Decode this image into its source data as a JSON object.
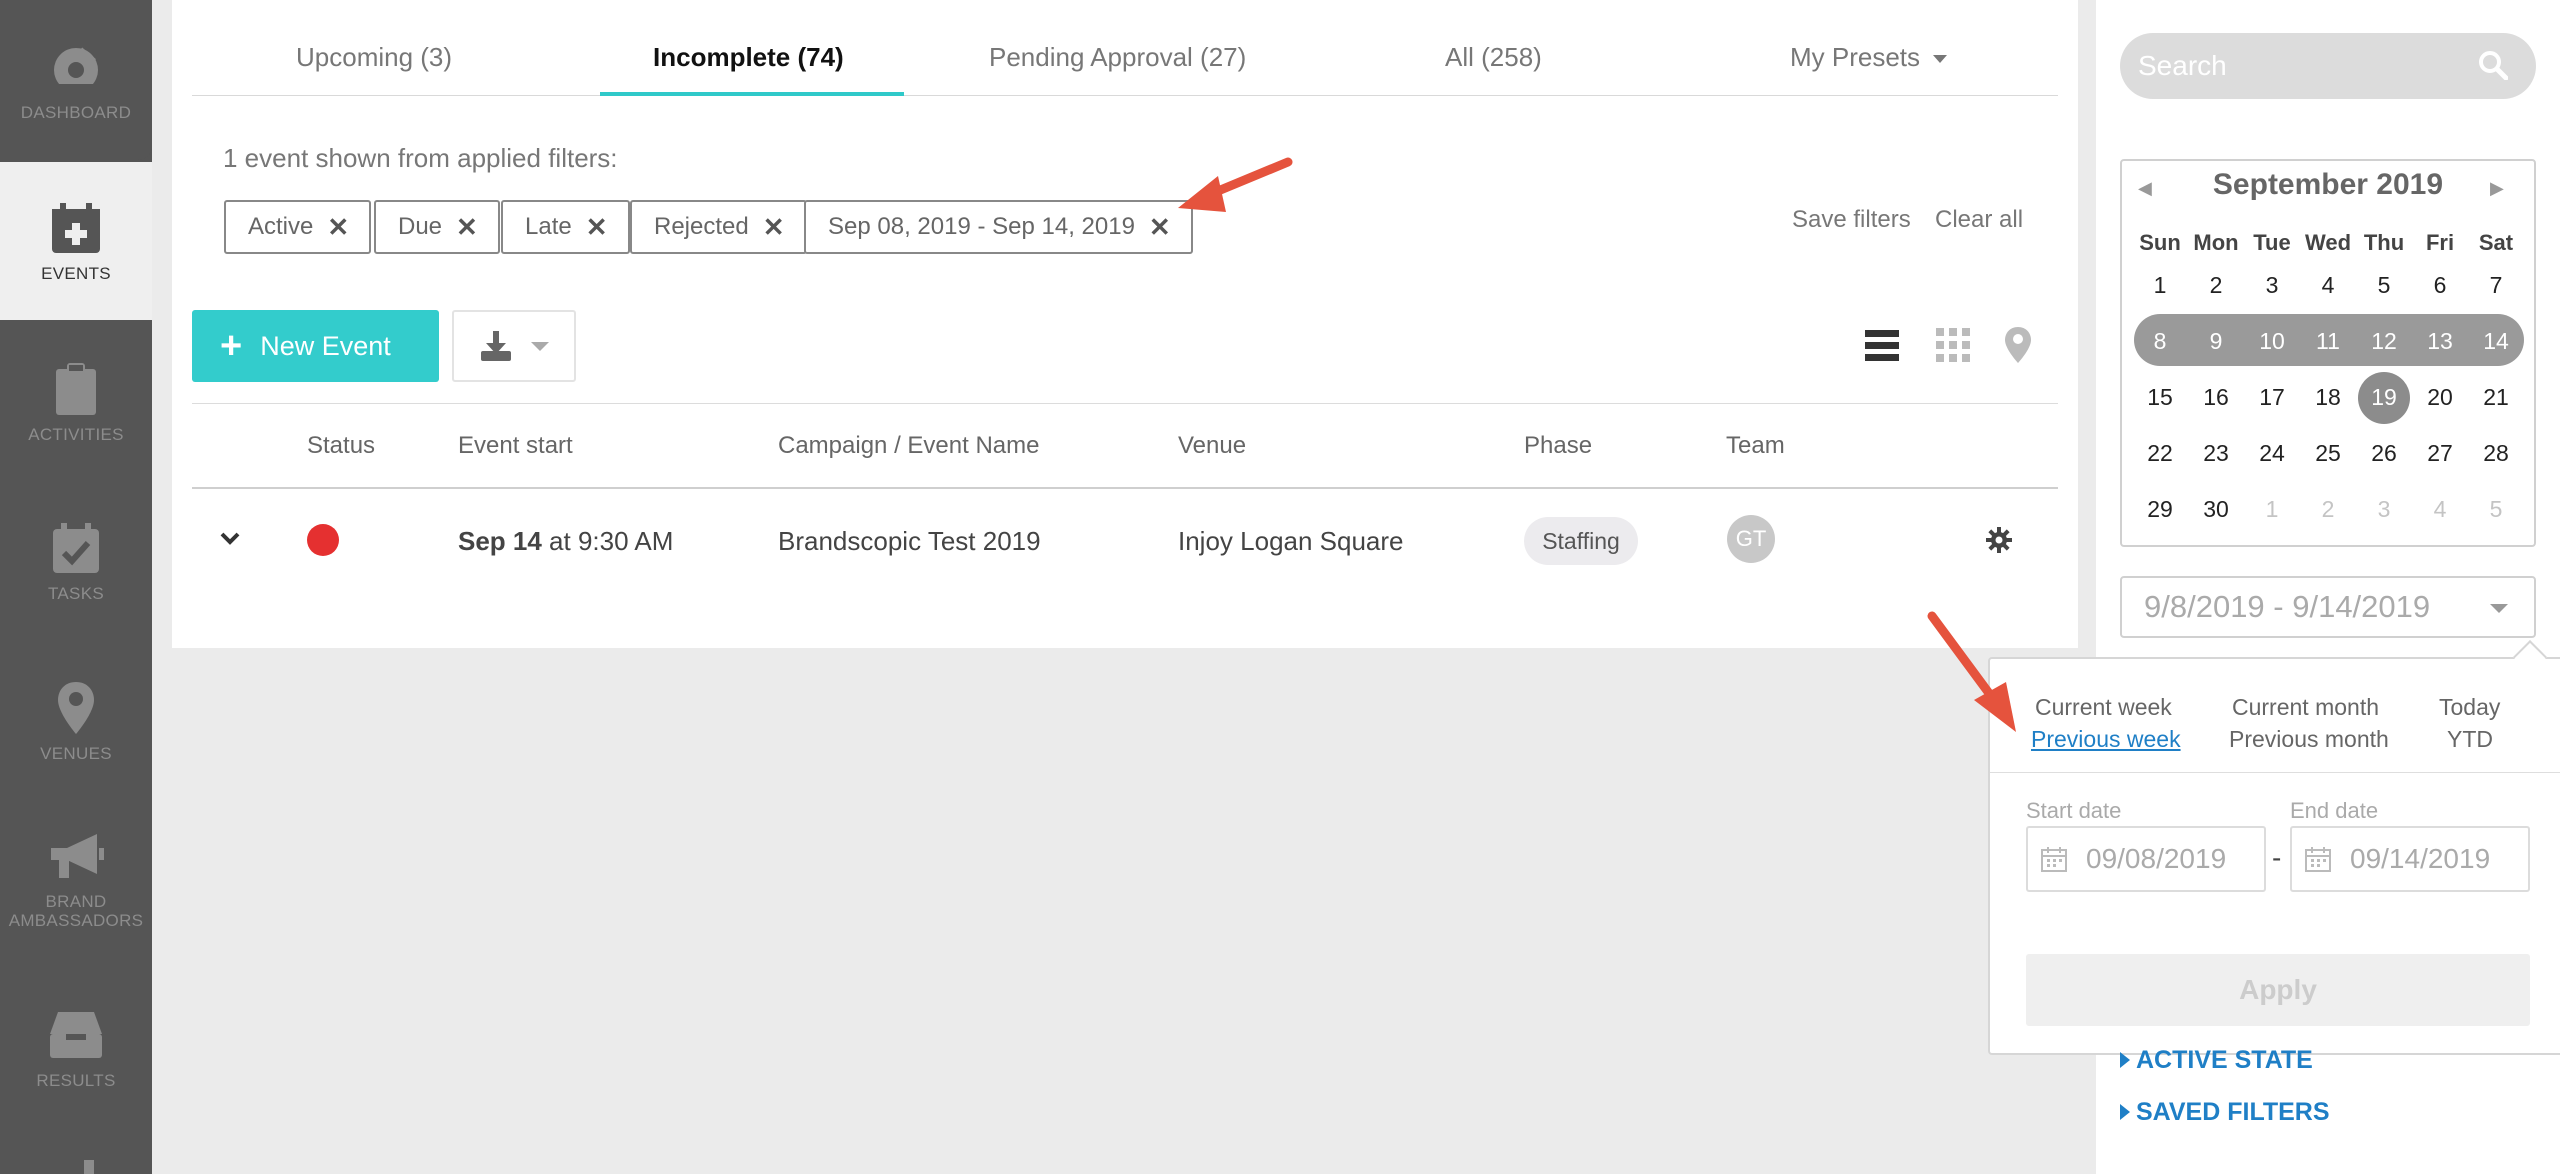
{
  "sidebar": {
    "items": [
      {
        "label": "DASHBOARD",
        "icon": "dashboard-gauge-icon"
      },
      {
        "label": "EVENTS",
        "icon": "calendar-plus-icon"
      },
      {
        "label": "ACTIVITIES",
        "icon": "clipboard-icon"
      },
      {
        "label": "TASKS",
        "icon": "calendar-check-icon"
      },
      {
        "label": "VENUES",
        "icon": "map-pin-icon"
      },
      {
        "label": "BRAND",
        "label2": "AMBASSADORS",
        "icon": "megaphone-icon"
      },
      {
        "label": "RESULTS",
        "icon": "inbox-tray-icon"
      }
    ]
  },
  "tabs": [
    {
      "label": "Upcoming (3)"
    },
    {
      "label": "Incomplete (74)"
    },
    {
      "label": "Pending Approval (27)"
    },
    {
      "label": "All (258)"
    },
    {
      "label": "My Presets"
    }
  ],
  "filters": {
    "summary": "1 event shown from applied filters:",
    "chips": [
      "Active",
      "Due",
      "Late",
      "Rejected",
      "Sep 08, 2019 - Sep 14, 2019"
    ],
    "remove_glyph": "✕",
    "save_label": "Save filters",
    "clear_label": "Clear all"
  },
  "toolbar": {
    "new_event_label": "New Event",
    "plus": "+"
  },
  "table": {
    "headers": [
      "Status",
      "Event start",
      "Campaign / Event Name",
      "Venue",
      "Phase",
      "Team"
    ],
    "row": {
      "date_bold": "Sep 14",
      "time": " at 9:30 AM",
      "campaign": "Brandscopic Test 2019",
      "venue": "Injoy Logan Square",
      "phase": "Staffing",
      "team_initials": "GT",
      "status_color": "#e53030"
    }
  },
  "search": {
    "placeholder": "Search"
  },
  "calendar": {
    "month_label": "September 2019",
    "prev": "◀",
    "next": "▶",
    "weekdays": [
      "Sun",
      "Mon",
      "Tue",
      "Wed",
      "Thu",
      "Fri",
      "Sat"
    ],
    "weeks": [
      [
        "1",
        "2",
        "3",
        "4",
        "5",
        "6",
        "7"
      ],
      [
        "8",
        "9",
        "10",
        "11",
        "12",
        "13",
        "14"
      ],
      [
        "15",
        "16",
        "17",
        "18",
        "19",
        "20",
        "21"
      ],
      [
        "22",
        "23",
        "24",
        "25",
        "26",
        "27",
        "28"
      ],
      [
        "29",
        "30",
        "1",
        "2",
        "3",
        "4",
        "5"
      ]
    ],
    "today": "19"
  },
  "range": {
    "value": "9/8/2019 - 9/14/2019"
  },
  "presets": {
    "current_week": "Current week",
    "previous_week": "Previous week",
    "current_month": "Current month",
    "previous_month": "Previous month",
    "today": "Today",
    "ytd": "YTD"
  },
  "date_inputs": {
    "start_label": "Start date",
    "end_label": "End date",
    "start_value": "09/08/2019",
    "end_value": "09/14/2019",
    "separator": "-"
  },
  "apply_label": "Apply",
  "sections": [
    "ACTIVE STATE",
    "SAVED FILTERS"
  ],
  "colors": {
    "accent": "#33cccc",
    "link": "#1f7fc6",
    "annotation_arrow": "#e5533d"
  }
}
